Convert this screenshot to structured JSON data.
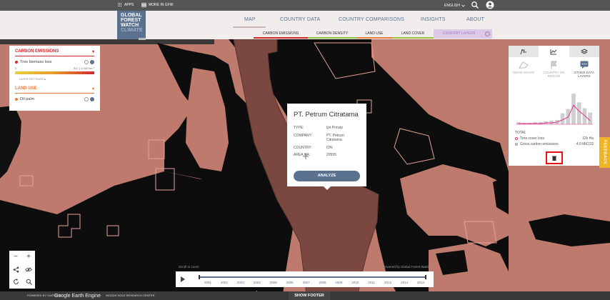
{
  "topbar": {
    "apps_label": "APPS",
    "more_label": "MORE IN GFW",
    "language": "ENGLISH"
  },
  "logo": {
    "line1": "GLOBAL",
    "line2": "FOREST",
    "line3": "WATCH",
    "line4": "CLIMATE"
  },
  "nav": {
    "map": "MAP",
    "country_data": "COUNTRY DATA",
    "country_comparisons": "COUNTRY COMPARISONS",
    "insights": "INSIGHTS",
    "about": "ABOUT"
  },
  "subtabs": {
    "carbon_emissions": "CARBON EMISSIONS",
    "carbon_density": "CARBON DENSITY",
    "land_use": "LAND USE",
    "land_cover": "LAND COVER",
    "country_layers": "COUNTRY LAYERS"
  },
  "colors": {
    "carbon_emissions": "#d3292b",
    "carbon_density": "#8fbe3e",
    "land_use": "#e87c3e",
    "land_cover": "#9bc63c",
    "country_layers": "#a47bc0",
    "accent": "#5a7190"
  },
  "legend": {
    "carbon_emissions_title": "CARBON EMISSIONS",
    "tree_biomass_loss": "Tree biomass loss",
    "scale_min": "0",
    "scale_max": "917 | 1,032 ha⁻¹",
    "layer_settings": "LAYER SETTINGS",
    "land_use_title": "LAND USE",
    "oil_palm": "Oil palm"
  },
  "popup": {
    "title": "PT. Petrum Citratama",
    "type_key": "TYPE:",
    "type_val": "Ijin Prinsip",
    "company_key": "COMPANY:",
    "company_val1": "PT. Petrum",
    "company_val2": "Citratama",
    "country_key": "COUNTRY:",
    "country_val": "IDN",
    "area_key": "AREA HA:",
    "area_val": "20555",
    "analyze": "ANALYZE"
  },
  "right_panel": {
    "draw_shape_1": "DRAW SHAPE",
    "country_1": "COUNTRY OR",
    "country_2": "REGION",
    "other_1": "OTHER DATA",
    "other_2": "LAYERS",
    "total_label": "TOTAL",
    "tree_cover_loss_label": "Tree cover loss",
    "tree_cover_loss_value": "12k Ha",
    "gross_emissions_label": "Gross carbon emissions",
    "gross_emissions_value": "4.0 MtCO2"
  },
  "feedback": "FEEDBACK",
  "timeline": {
    "years": [
      "2001",
      "2002",
      "2003",
      "2004",
      "2005",
      "2006",
      "2007",
      "2008",
      "2009",
      "2010",
      "2011",
      "2012",
      "2013",
      "2014"
    ],
    "note_left": "Scroll to zoom",
    "note_right": "Powered by Global Forest Watch"
  },
  "footer": {
    "show_footer": "SHOW FOOTER",
    "cartodb": "POWERED BY CARTODB",
    "google": "Google Earth Engine",
    "woods": "WOODS HOLE RESEARCH CENTER"
  },
  "chart_data": {
    "type": "bar",
    "categories": [
      "2001",
      "2002",
      "2003",
      "2004",
      "2005",
      "2006",
      "2007",
      "2008",
      "2009",
      "2010",
      "2011",
      "2012",
      "2013",
      "2014"
    ],
    "series": [
      {
        "values": [
          0.3,
          0.2,
          0.2,
          0.3,
          0.3,
          0.4,
          0.5,
          0.6,
          1.5,
          2.1,
          4.2,
          3.0,
          2.2,
          1.6
        ]
      },
      {
        "values": [
          0.1,
          0.1,
          0.1,
          0.1,
          0.1,
          0.2,
          0.2,
          0.3,
          0.6,
          1.0,
          2.6,
          1.8,
          1.2,
          0.5
        ]
      }
    ]
  }
}
